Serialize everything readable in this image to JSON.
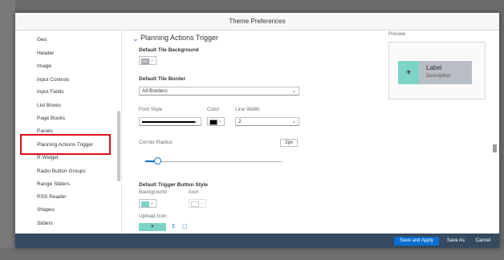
{
  "dialog": {
    "title": "Theme Preferences"
  },
  "sidebar": {
    "items": [
      {
        "label": "Geo"
      },
      {
        "label": "Header"
      },
      {
        "label": "Image"
      },
      {
        "label": "Input Controls"
      },
      {
        "label": "Input Fields"
      },
      {
        "label": "List Boxes"
      },
      {
        "label": "Page Books"
      },
      {
        "label": "Panels"
      },
      {
        "label": "Planning Actions Trigger"
      },
      {
        "label": "R Widget"
      },
      {
        "label": "Radio Button Groups"
      },
      {
        "label": "Range Sliders"
      },
      {
        "label": "RSS Reader"
      },
      {
        "label": "Shapes"
      },
      {
        "label": "Sliders"
      }
    ],
    "selected_index": 8
  },
  "section": {
    "title": "Planning Actions Trigger",
    "tile_background_label": "Default Tile Background",
    "tile_border_label": "Default Tile Border",
    "border_select_value": "All Borders",
    "font_style_label": "Font Style",
    "color_label": "Color",
    "line_width_label": "Line Width",
    "line_width_value": "2",
    "corner_radius_label": "Corner Radius",
    "corner_radius_value": "2px",
    "trigger_style_label": "Default Trigger Button Style",
    "background_label": "Background",
    "icon_label": "Icon",
    "upload_icon_label": "Upload Icon"
  },
  "preview": {
    "label": "Preview",
    "tile_label": "Label",
    "tile_description": "Description"
  },
  "footer": {
    "save_apply": "Save and Apply",
    "save_as": "Save As",
    "cancel": "Cancel"
  },
  "colors": {
    "accent": "#0a6ed1",
    "teal": "#7ed3c7",
    "footer_bg": "#354a5f",
    "highlight_box": "#e0101a"
  },
  "icons": {
    "section_toggle": "chevron-down-icon",
    "trigger_icon": "pin-icon"
  }
}
